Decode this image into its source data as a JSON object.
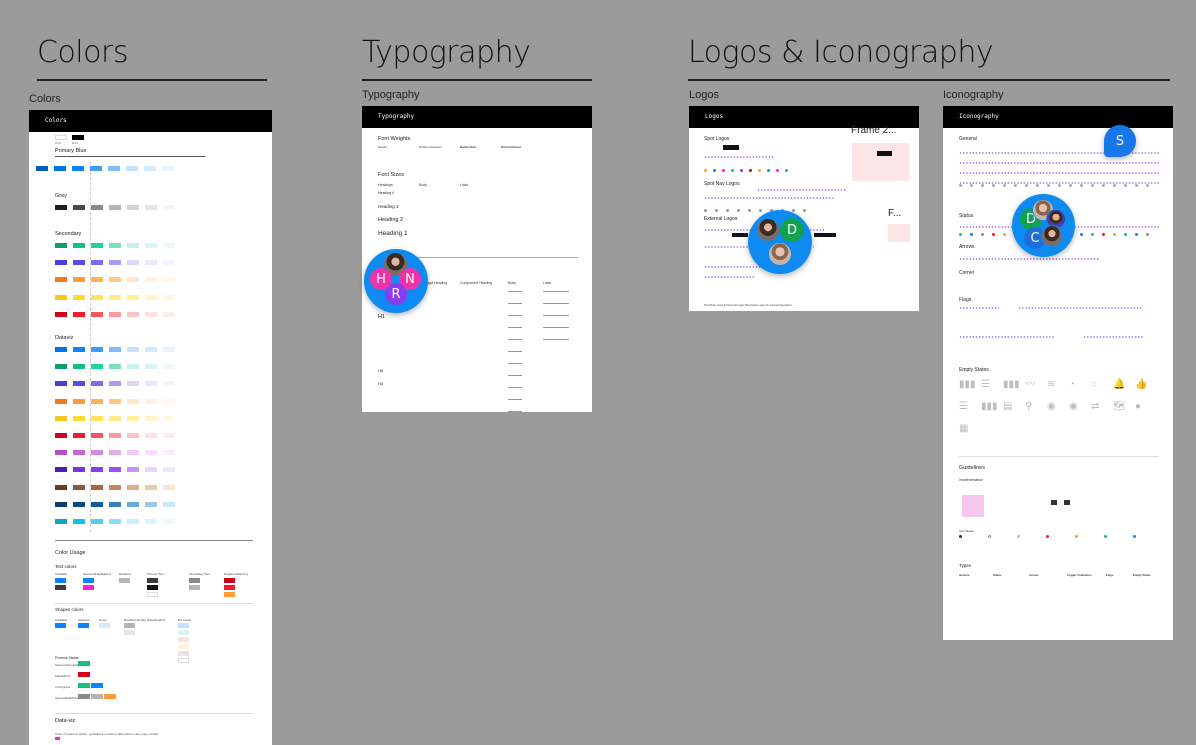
{
  "canvas": {
    "sections": [
      {
        "title": "Colors"
      },
      {
        "title": "Typography"
      },
      {
        "title": "Logos & Iconography"
      }
    ],
    "frames": {
      "colors": {
        "label": "Colors",
        "header": "Colors",
        "base_swatches": [
          "White",
          "Black"
        ],
        "groups": [
          {
            "title": "Primary Blue",
            "colors": [
              "#005eb8",
              "#0073e6",
              "#0a84ff",
              "#3d9df5",
              "#7fbdf7",
              "#c6e1fb",
              "#d5ebfc",
              "#eaf5fe"
            ]
          },
          {
            "title": "Grey",
            "colors": [
              "#1e1e1e",
              "#4a4a4a",
              "#8a8a8a",
              "#b5b5b5",
              "#d4d4d4",
              "#e6e6e6",
              "#f5f5f5"
            ]
          },
          {
            "title": "Secondary",
            "rows": [
              [
                "#0c9e6e",
                "#13c07f",
                "#1ed49a",
                "#7de0bd",
                "#c6f1ed",
                "#d8f4f4",
                "#eef9fb"
              ],
              [
                "#4b3ddc",
                "#5a4ae8",
                "#7a6ef0",
                "#a79df5",
                "#ddd6fb",
                "#ebe7fd",
                "#f5f3fe"
              ],
              [
                "#f07a24",
                "#ff9b38",
                "#ffb25e",
                "#ffc88b",
                "#fde8c9",
                "#fef1e2",
                "#fff6ef"
              ],
              [
                "#f7c81c",
                "#ffd92e",
                "#ffe45a",
                "#ffec86",
                "#fff19a",
                "#fff4cc",
                "#fff8e1"
              ],
              [
                "#d0021b",
                "#f21b2d",
                "#f5555f",
                "#f89aa0",
                "#fbc5c8",
                "#fde0e2",
                "#fdeeee"
              ]
            ]
          },
          {
            "title": "Dataviz",
            "rows": [
              [
                "#0073e6",
                "#0a84ff",
                "#3d9df5",
                "#7fbdf7",
                "#c6e1fb",
                "#d5ebfc",
                "#eaf5fe"
              ],
              [
                "#0c9e6e",
                "#13c07f",
                "#1ed49a",
                "#7de0bd",
                "#c6f1ed",
                "#d8f4f4",
                "#eef9fb"
              ],
              [
                "#4b3ddc",
                "#5a4ae8",
                "#7a6ef0",
                "#a79df5",
                "#ddd6fb",
                "#ebe7fd",
                "#f5f3fe"
              ],
              [
                "#f07a24",
                "#ff9b38",
                "#ffb25e",
                "#ffc88b",
                "#fde8c9",
                "#fef1e2",
                "#fff6ef"
              ],
              [
                "#f7c81c",
                "#ffd92e",
                "#ffe45a",
                "#ffec86",
                "#fff19a",
                "#fff4cc",
                "#fff8e1"
              ],
              [
                "#d0021b",
                "#f21b2d",
                "#f5555f",
                "#f89aa0",
                "#fbc5c8",
                "#fde0e2",
                "#fdeeee"
              ],
              [
                "#b44fc4",
                "#c765d6",
                "#d48ae0",
                "#e2abea",
                "#f1c9f5",
                "#f8ddfa",
                "#fbeefc"
              ],
              [
                "#4a1fa8",
                "#7b33d8",
                "#8b3ee6",
                "#9b4ff5",
                "#c796ee",
                "#e6d4fa",
                "#f1e8fd"
              ],
              [
                "#6b3f22",
                "#8b5a3a",
                "#a46a44",
                "#bf8a64",
                "#d9b08c",
                "#ebcaa6",
                "#fbe4c9"
              ],
              [
                "#0c3d6e",
                "#0e4a82",
                "#0d5ba5",
                "#3a7fb8",
                "#6aa8d6",
                "#9cc6ea",
                "#c9e5f8"
              ],
              [
                "#0aa6c4",
                "#13c2e3",
                "#55cdf1",
                "#8fdcf6",
                "#c6eefb",
                "#dcf5fd",
                "#eefafe"
              ]
            ]
          }
        ],
        "usage": {
          "title": "Color Usage",
          "text_colors_title": "Text colors",
          "text_color_columns": [
            "Clickable",
            "Selected/Highlighted",
            "Disabled",
            "Primary Text",
            "Secondary Text",
            "Negative/Warning"
          ],
          "shape_colors_title": "Shapes colors",
          "shape_color_columns": [
            "Clickable",
            "Selected",
            "Hover",
            "Disabled /Empty State/Dividers",
            "BG colors"
          ],
          "process_status_title": "Process Status",
          "process_status_rows": [
            "Success/Complete",
            "Failed/Error",
            "In Progress",
            "Queued/Idle/Paused"
          ],
          "dataviz_title": "Data-viz",
          "dataviz_note": "Order of colors in charts - guidelines on how to add colors to any type of chart"
        }
      },
      "typography": {
        "label": "Typography",
        "header": "Typography",
        "font_weights_title": "Font Weights",
        "font_weights": [
          "Regular",
          "Medium Condensed",
          "Medium Bold",
          "Bold Condensed"
        ],
        "font_sizes_title": "Font Sizes",
        "font_size_columns": [
          "Headings",
          "Body",
          "Links"
        ],
        "headings": [
          "Heading 4",
          "Heading 3",
          "Heading 2",
          "Heading 1"
        ],
        "lower_columns": [
          "Page Heading",
          "Component Heading",
          "Body",
          "Links"
        ],
        "lower_headings": [
          "H1",
          "H5",
          "H3"
        ]
      },
      "logos": {
        "label": "Logos",
        "header": "Logos",
        "sections": [
          "Spot Logos",
          "Spot Nav Logos",
          "External Logos"
        ],
        "side_frames": [
          "Frame 2...",
          "F..."
        ],
        "footnote": "Third-Party Icons for External Logos   Placeholder Logos for external Integrations"
      },
      "iconography": {
        "label": "Iconography",
        "header": "Iconography",
        "sections": [
          "General",
          "Status",
          "Arrows",
          "Corner",
          "Flags",
          "Empty States"
        ],
        "guidelines_title": "Guidelines",
        "guidelines_sub": "Implementation",
        "guidelines_sections": [
          "Icon States",
          "Types"
        ],
        "types": [
          "Generic",
          "Status",
          "Arrows",
          "Toggle / Indicators",
          "Flags",
          "Empty States"
        ]
      }
    },
    "collaborators": [
      {
        "group": "typography",
        "initials": [
          "H",
          "N",
          "R"
        ],
        "colors": [
          "#f032a9",
          "#f032a9",
          "#8a3cf0"
        ]
      },
      {
        "group": "logos",
        "initials": [
          "D"
        ],
        "colors": [
          "#12a150"
        ]
      },
      {
        "group": "iconography",
        "initials": [
          "D",
          "C"
        ],
        "colors": [
          "#12a150",
          "#1e6fd9"
        ]
      },
      {
        "group": "iconography-cursor",
        "initials": [
          "S"
        ],
        "colors": [
          "#1877e8"
        ]
      }
    ],
    "accent": "#0d8bf2"
  }
}
